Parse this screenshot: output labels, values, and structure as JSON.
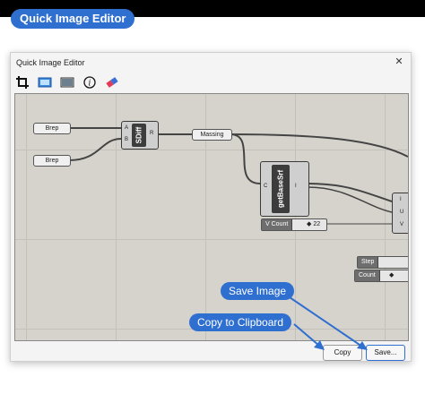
{
  "header_badge": "Quick Image Editor",
  "window": {
    "title": "Quick Image Editor",
    "close_glyph": "✕",
    "toolbar": [
      {
        "name": "crop-icon"
      },
      {
        "name": "viewport-icon"
      },
      {
        "name": "image-icon"
      },
      {
        "name": "info-icon"
      },
      {
        "name": "eraser-icon"
      }
    ],
    "buttons": {
      "copy": "Copy",
      "save": "Save..."
    }
  },
  "canvas": {
    "params": {
      "brep1": "Brep",
      "brep2": "Brep",
      "massing": "Massing"
    },
    "sdiff": {
      "label": "SDiff",
      "in_a": "A",
      "in_b": "B",
      "out": "R"
    },
    "getbasesrf": {
      "label": "getBaseSrf",
      "in": "C",
      "out": "I"
    },
    "partial": {
      "i": "I",
      "u": "U",
      "v": "V"
    },
    "sliders": [
      {
        "label": "V Count",
        "value": "◆ 22"
      },
      {
        "label": "Step",
        "value": ""
      },
      {
        "label": "Count",
        "value": "◆"
      }
    ]
  },
  "callouts": {
    "save_image": "Save Image",
    "copy_clipboard": "Copy to Clipboard"
  },
  "colors": {
    "accent": "#2f6fd0",
    "canvas": "#d6d3cc"
  }
}
